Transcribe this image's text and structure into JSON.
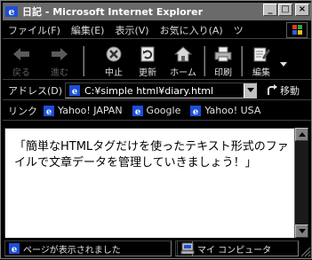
{
  "window": {
    "title": "日記 - Microsoft Internet Explorer",
    "controls": {
      "minimize": "_",
      "maximize": "□",
      "close": "×"
    }
  },
  "menu": {
    "items": [
      "ファイル(F)",
      "編集(E)",
      "表示(V)",
      "お気に入り(A)",
      "ツ"
    ]
  },
  "toolbar": {
    "back": "戻る",
    "forward": "進む",
    "stop": "中止",
    "refresh": "更新",
    "home": "ホーム",
    "print": "印刷",
    "edit": "編集"
  },
  "address": {
    "label": "アドレス(D)",
    "value": "C:¥simple html¥diary.html",
    "go": "移動"
  },
  "links": {
    "label": "リンク",
    "items": [
      "Yahoo! JAPAN",
      "Google",
      "Yahoo! USA"
    ]
  },
  "page": {
    "text": "「簡単なHTMLタグだけを使ったテキスト形式のファイルで文章データを管理していきましょう！」"
  },
  "status": {
    "message": "ページが表示されました",
    "zone": "マイ コンピュータ"
  },
  "colors": {
    "titlebar": "#6a6a6a",
    "chrome": "#000000",
    "content_bg": "#ffffff"
  }
}
